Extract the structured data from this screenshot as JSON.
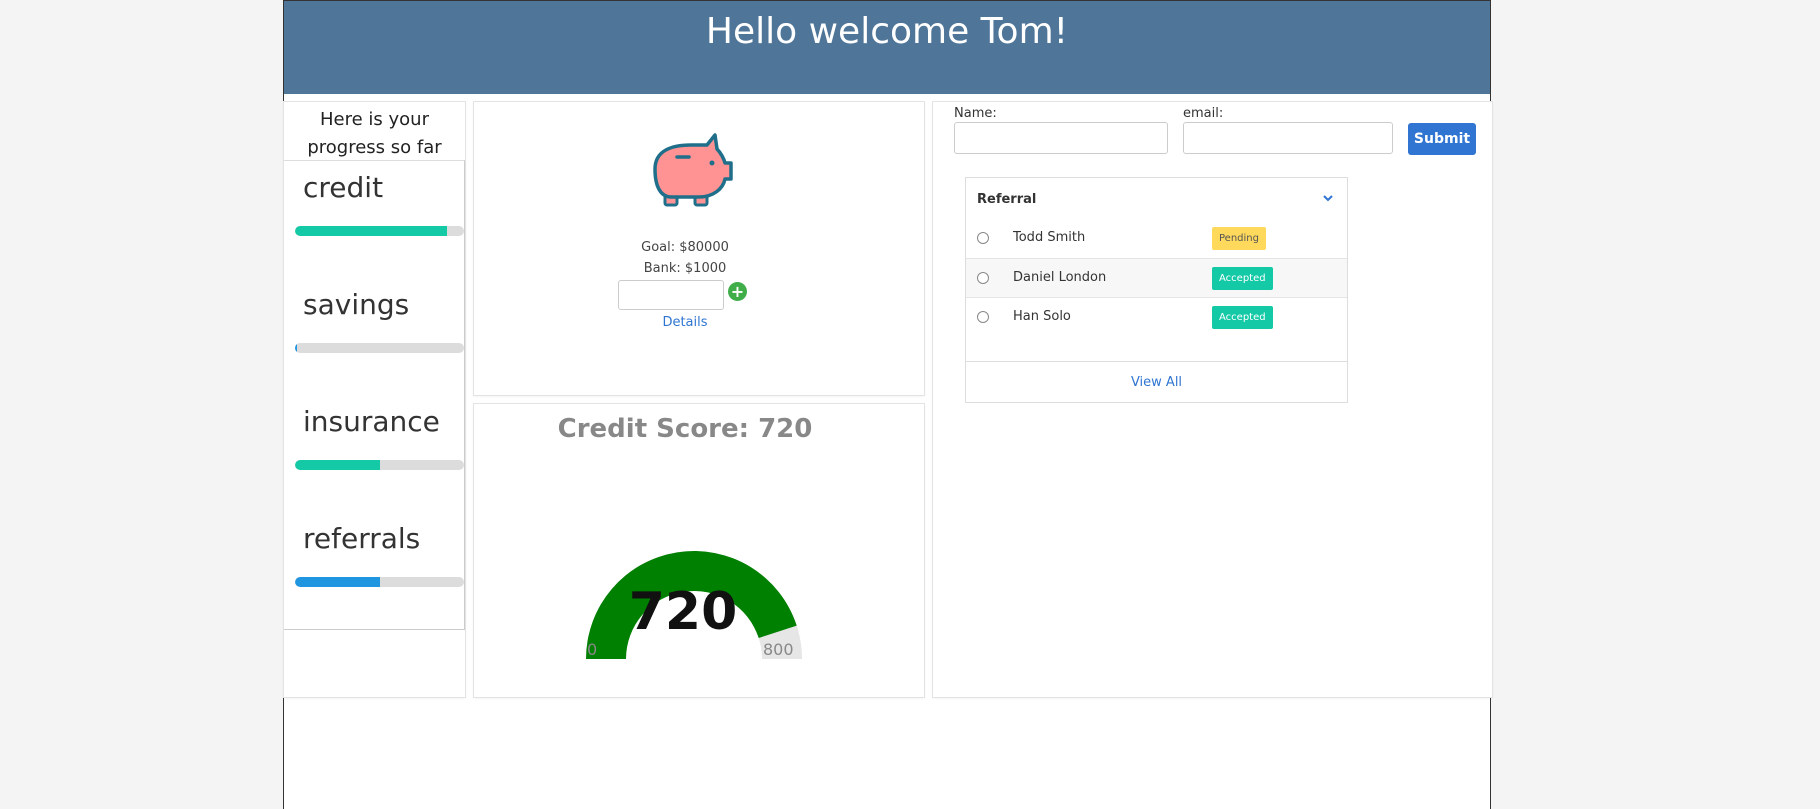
{
  "header": {
    "title": "Hello welcome Tom!"
  },
  "progress": {
    "title": "Here is your progress so far",
    "items": [
      {
        "label": "credit",
        "fraction": 0.9,
        "color": "#13c9a6"
      },
      {
        "label": "savings",
        "fraction": 0.01,
        "color": "#2196e0"
      },
      {
        "label": "insurance",
        "fraction": 0.5,
        "color": "#13c9a6"
      },
      {
        "label": "referrals",
        "fraction": 0.5,
        "color": "#2196e0"
      }
    ]
  },
  "savings": {
    "icon": "piggy-bank-icon",
    "goal": "Goal: $80000",
    "bank": "Bank: $1000",
    "add_icon": "plus-circle-icon",
    "details_label": "Details"
  },
  "credit": {
    "title": "Credit Score: 720",
    "score": "720",
    "min": "0",
    "max": "800",
    "fraction": 0.9,
    "fill_color": "#008000",
    "track_color": "#e6e6e6"
  },
  "referral_form": {
    "name_label": "Name:",
    "email_label": "email:",
    "submit_label": "Submit"
  },
  "referral_list": {
    "title": "Referral",
    "collapse_icon": "chevron-down-icon",
    "rows": [
      {
        "name": "Todd Smith",
        "status": "Pending"
      },
      {
        "name": "Daniel London",
        "status": "Accepted"
      },
      {
        "name": "Han Solo",
        "status": "Accepted"
      }
    ],
    "view_all_label": "View All"
  }
}
